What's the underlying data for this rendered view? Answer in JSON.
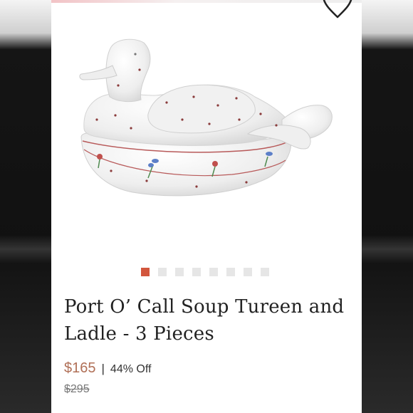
{
  "product": {
    "title_line1": "Port O’ Call Soup Tureen and",
    "title_line2": "Ladle - 3 Pieces",
    "price": "$165",
    "separator": "|",
    "discount": "44% Off",
    "original_price": "$295"
  },
  "carousel": {
    "total_images": 8,
    "active_index": 0
  },
  "icons": {
    "like": "heart-outline-icon"
  },
  "colors": {
    "accent": "#d2563d",
    "price": "#b06f56",
    "dot_inactive": "#e6e6e6",
    "title": "#222222"
  }
}
